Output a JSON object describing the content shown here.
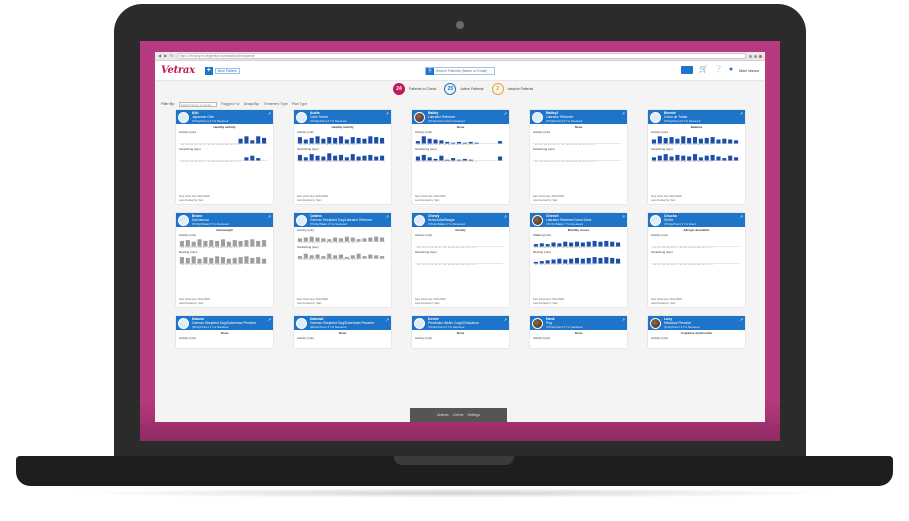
{
  "browser": {
    "url": "https://treatvy.vt.vegtrellar.com/fast/patientqueue"
  },
  "header": {
    "logo_main": "Vetrax",
    "new_patient_label": "New Patient",
    "search_placeholder": "Search Patients (Name or Email)",
    "username": "Mari Vance"
  },
  "counts": [
    {
      "value": "24",
      "label": "Patients to Check"
    },
    {
      "value": "25",
      "label": "Active Patients"
    },
    {
      "value": "2",
      "label": "Inactive Patients"
    }
  ],
  "filters": {
    "filter_by": "Filter By:",
    "input_placeholder": "Patient Name or Email",
    "flagged": "Flagged For",
    "group_by": "Group By:",
    "treatment": "Treatment Type",
    "plan": "Plan Type"
  },
  "x_ticks": "12 13 14 15 16 17 18 19 20 21 22 23 1 2 3",
  "patients": [
    {
      "name": "Kiki",
      "breed": "Japanese Chin",
      "meta": "(7th/4yr/Fem) 4 Yrs Neutered",
      "status": "Healthy activity",
      "m1": "Activity (min)",
      "m2": "Scratching (sec)",
      "photo": false,
      "values1": [
        0,
        0,
        0,
        0,
        0,
        0,
        0,
        0,
        0,
        0,
        0.6,
        0.9,
        0.4,
        0.9,
        0.7
      ],
      "values2": [
        0,
        0,
        0,
        0,
        0,
        0,
        0,
        0,
        0,
        0,
        0,
        0.4,
        0.6,
        0.3,
        0
      ],
      "foot1": "Next check due: 04/11/2020",
      "foot2": "Last checked by: Sam"
    },
    {
      "name": "Audie",
      "breed": "Cairn Terrier",
      "meta": "(7th/4yr/Fem) 3 Yrs Neutered",
      "status": "Healthy activity",
      "m1": "Activity (min)",
      "m2": "Scratching (sec)",
      "photo": false,
      "values1": [
        0.8,
        0.5,
        0.7,
        0.9,
        0.6,
        0.8,
        0.7,
        0.9,
        0.5,
        0.8,
        0.7,
        0.6,
        0.9,
        0.8,
        0.7
      ],
      "values2": [
        0.7,
        0.4,
        0.8,
        0.6,
        0.5,
        0.9,
        0.6,
        0.7,
        0.4,
        0.8,
        0.5,
        0.6,
        0.7,
        0.5,
        0.6
      ],
      "foot1": "Next check due: 04/11/2020",
      "foot2": "Last checked by: Sam"
    },
    {
      "name": "Bailey",
      "breed": "Labrador Retriever",
      "meta": "(7th/4yr/Fem) 10yrs Neutered",
      "status": "None",
      "m1": "Activity (min)",
      "m2": "Scratching (sec)",
      "photo": true,
      "values1": [
        0.3,
        0.9,
        0.6,
        0.5,
        0.4,
        0.2,
        0.1,
        0.2,
        0.1,
        0.2,
        0.1,
        0,
        0,
        0,
        0.3
      ],
      "values2": [
        0.5,
        0.7,
        0.4,
        0.2,
        0.6,
        0.1,
        0.3,
        0.1,
        0.2,
        0.1,
        0,
        0,
        0,
        0,
        0.5
      ],
      "foot1": "Next check due: 04/11/2020",
      "foot2": "Last checked by: Sam"
    },
    {
      "name": "Bailey2",
      "breed": "Labrador Retriever",
      "meta": "(7th/4yr/Fem) 9 Yrs Neutered",
      "status": "None",
      "m1": "Activity (min)",
      "m2": "Scratching (sec)",
      "photo": false,
      "values1": [
        0,
        0,
        0,
        0,
        0,
        0,
        0,
        0,
        0,
        0,
        0,
        0,
        0,
        0,
        0
      ],
      "values2": [
        0,
        0,
        0,
        0,
        0,
        0,
        0,
        0,
        0,
        0,
        0,
        0,
        0,
        0,
        0
      ],
      "foot1": "Next check due: 04/11/2020",
      "foot2": "Last checked by: Sam"
    },
    {
      "name": "Bonnie",
      "breed": "Coton de Tulear",
      "meta": "(7th/4yr/Fem) 8 Yrs Neutered",
      "status": "Balance",
      "m1": "Activity (min)",
      "m2": "Scratching (sec)",
      "photo": false,
      "values1": [
        0.5,
        0.9,
        0.7,
        0.8,
        0.6,
        0.9,
        0.7,
        0.8,
        0.6,
        0.7,
        0.8,
        0.5,
        0.6,
        0.5,
        0.4
      ],
      "values2": [
        0.4,
        0.6,
        0.8,
        0.5,
        0.7,
        0.6,
        0.5,
        0.8,
        0.4,
        0.6,
        0.7,
        0.5,
        0.3,
        0.6,
        0.4
      ],
      "foot1": "Next check due: 04/11/2020",
      "foot2": "Last checked by: Sam"
    },
    {
      "name": "Bruno",
      "breed": "Dachshund",
      "meta": "(7th/5yr/Male) 6 Yrs Neutered",
      "status": "Overweight",
      "m1": "Activity (min)",
      "m2": "Resting (min)",
      "photo": false,
      "gray": true,
      "values1": [
        0.7,
        0.8,
        0.6,
        0.9,
        0.7,
        0.8,
        0.7,
        0.9,
        0.6,
        0.8,
        0.7,
        0.8,
        0.9,
        0.7,
        0.8
      ],
      "values2": [
        0.8,
        0.7,
        0.9,
        0.6,
        0.8,
        0.7,
        0.9,
        0.8,
        0.6,
        0.7,
        0.8,
        0.9,
        0.7,
        0.8,
        0.6
      ],
      "foot1": "Next check due: 04/11/2020",
      "foot2": "Last checked by: Sam"
    },
    {
      "name": "Casino",
      "breed": "German Shepherd Dog/Labrador Retriever",
      "meta": "(7th/4yr/Male) 3 Yrs Neutered",
      "status": "",
      "m1": "Activity (min)",
      "m2": "Scratching (sec)",
      "photo": false,
      "gray": true,
      "values1": [
        0.4,
        0.5,
        0.6,
        0.5,
        0.4,
        0.3,
        0.5,
        0.4,
        0.6,
        0.5,
        0.3,
        0.4,
        0.5,
        0.6,
        0.5
      ],
      "values2": [
        0.3,
        0.6,
        0.4,
        0.5,
        0.3,
        0.6,
        0.4,
        0.5,
        0.2,
        0.4,
        0.6,
        0.3,
        0.5,
        0.4,
        0.3
      ],
      "foot1": "Next check due: 04/11/2020",
      "foot2": "Last checked by: Sam"
    },
    {
      "name": "Chewy",
      "breed": "Schnoodle/Beagle",
      "meta": "(7th/4yr/Male) 4 Yrs Neutered",
      "status": "Anxiety",
      "m1": "Activity (min)",
      "m2": "Scratching (sec)",
      "photo": false,
      "values1": [
        0,
        0,
        0,
        0,
        0,
        0,
        0,
        0,
        0,
        0,
        0,
        0,
        0,
        0,
        0
      ],
      "values2": [
        0,
        0,
        0,
        0,
        0,
        0,
        0,
        0,
        0,
        0,
        0,
        0,
        0,
        0,
        0
      ],
      "foot1": "Next check due: 04/11/2020",
      "foot2": "Last checked by: Sam"
    },
    {
      "name": "Cheech",
      "breed": "Labrador Retriever/Great Dane",
      "meta": "(7th/7yr/Male) 7 Yrs Neutered",
      "status": "Mobility issues",
      "m1": "Walking (min)",
      "m2": "Resting (min)",
      "photo": true,
      "values1": [
        0.3,
        0.4,
        0.3,
        0.5,
        0.4,
        0.6,
        0.5,
        0.6,
        0.5,
        0.6,
        0.7,
        0.6,
        0.7,
        0.6,
        0.5
      ],
      "values2": [
        0.2,
        0.3,
        0.4,
        0.5,
        0.6,
        0.5,
        0.6,
        0.7,
        0.6,
        0.7,
        0.8,
        0.7,
        0.8,
        0.7,
        0.6
      ],
      "foot1": "Next check due: 04/11/2020",
      "foot2": "Last checked by: Sam"
    },
    {
      "name": "Chucka",
      "breed": "Shihtz",
      "meta": "(7th/4yr/Fem) 5 Yrs Intact",
      "status": "Allergic dermatitis",
      "m1": "Activity (min)",
      "m2": "Scratching (sec)",
      "photo": false,
      "values1": [
        0,
        0,
        0,
        0,
        0,
        0,
        0,
        0,
        0,
        0,
        0,
        0,
        0,
        0,
        0
      ],
      "values2": [
        0,
        0,
        0,
        0,
        0,
        0,
        0,
        0,
        0,
        0,
        0,
        0,
        0,
        0,
        0
      ],
      "foot1": "Next check due: 04/11/2020",
      "foot2": "Last checked by: Sam"
    },
    {
      "name": "Dakota",
      "breed": "German Shepherd Dog/Doberman Pinscher",
      "meta": "(6th/1yr/Fem) 4 Yrs Neutered",
      "status": "None",
      "m1": "Activity (min)",
      "photo": false,
      "short": true
    },
    {
      "name": "Dakota2",
      "breed": "German Shepherd Dog/Doberman Pinscher",
      "meta": "(6th/1yr/Fem) 4 Yrs Neutered",
      "status": "None",
      "m1": "Activity (min)",
      "photo": false,
      "short": true
    },
    {
      "name": "Dexter",
      "breed": "Pembroke Welsh Corgi/Chihuahua",
      "meta": "(7th/1yr/Fem) 5 Yrs Neutered",
      "status": "None",
      "m1": "Activity (min)",
      "photo": false,
      "short": true
    },
    {
      "name": "Hank",
      "breed": "Pug",
      "meta": "(7th/1yr/Fem) 5 Yrs Neutered",
      "status": "None",
      "m1": "Activity (min)",
      "photo": true,
      "short": true
    },
    {
      "name": "Lucy",
      "breed": "Miniature Pinscher",
      "meta": "(11/2yr/Fem) 4 Yrs Neutered",
      "status": "Cognitive dysfunction",
      "m1": "Activity (min)",
      "photo": true,
      "short": true
    }
  ],
  "bottombar": {
    "items": [
      "Notices",
      "Clients",
      "Settings"
    ]
  },
  "colors": {
    "brand_blue": "#1e74c8",
    "brand_magenta": "#c2185b",
    "bezel": "#b63a7e"
  }
}
